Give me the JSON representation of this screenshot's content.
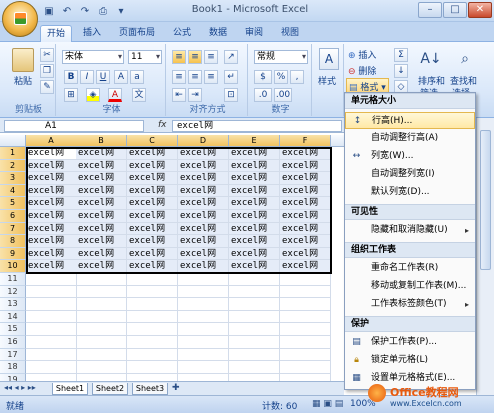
{
  "window": {
    "title": "Book1 - Microsoft Excel"
  },
  "quick_access": [
    "save-icon",
    "undo-icon",
    "redo-icon",
    "print-preview-icon",
    "customize-icon"
  ],
  "tabs": [
    "开始",
    "插入",
    "页面布局",
    "公式",
    "数据",
    "审阅",
    "视图"
  ],
  "ribbon": {
    "clipboard": {
      "label": "剪贴板",
      "paste": "粘贴"
    },
    "font": {
      "label": "字体",
      "name": "宋体",
      "size": "11",
      "bold": "B",
      "italic": "I",
      "underline": "U"
    },
    "alignment": {
      "label": "对齐方式"
    },
    "number": {
      "label": "数字",
      "format": "常规",
      "percent": "%",
      "comma": ","
    },
    "styles": {
      "label": "样式"
    },
    "cells": {
      "insert": "插入",
      "delete": "删除",
      "format": "格式"
    },
    "editing": {
      "sort": "排序和",
      "find": "查找和",
      "filter": "筛选",
      "select": "选择"
    }
  },
  "formula": {
    "name_box": "A1",
    "fx": "fx",
    "content": "excel网"
  },
  "grid": {
    "columns": [
      "A",
      "B",
      "C",
      "D",
      "E",
      "F"
    ],
    "rows": [
      "1",
      "2",
      "3",
      "4",
      "5",
      "6",
      "7",
      "8",
      "9",
      "10",
      "11",
      "12",
      "13",
      "14",
      "15",
      "16",
      "17",
      "18",
      "19"
    ],
    "cell_text": "excel网",
    "filled_rows": 10
  },
  "sheets": [
    "Sheet1",
    "Sheet2",
    "Sheet3"
  ],
  "status": {
    "ready": "就绪",
    "count": "计数: 60",
    "zoom": "100%"
  },
  "format_menu": {
    "section_size": "单元格大小",
    "row_height": "行高(H)...",
    "autofit_row": "自动调整行高(A)",
    "col_width": "列宽(W)...",
    "autofit_col": "自动调整列宽(I)",
    "default_width": "默认列宽(D)...",
    "section_visibility": "可见性",
    "hide_unhide": "隐藏和取消隐藏(U)",
    "section_organize": "组织工作表",
    "rename": "重命名工作表(R)",
    "move_copy": "移动或复制工作表(M)...",
    "tab_color": "工作表标签颜色(T)",
    "section_protect": "保护",
    "protect_sheet": "保护工作表(P)...",
    "lock_cell": "锁定单元格(L)",
    "format_cells": "设置单元格格式(E)..."
  },
  "watermark": {
    "line1": "Office教程网",
    "line2": "www.Excelcn.com"
  }
}
